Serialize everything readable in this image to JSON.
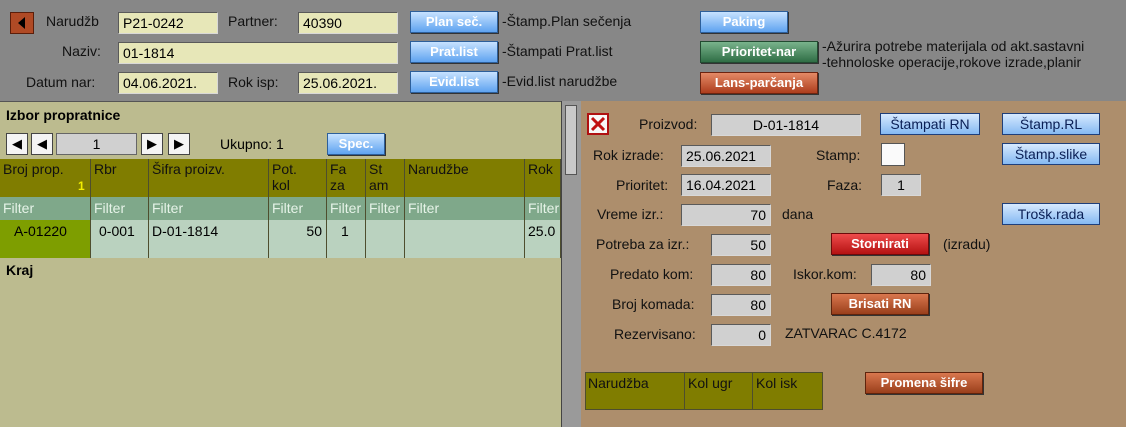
{
  "header": {
    "back_icon": "triangle-left-icon",
    "narudzba_label": "Narudžb",
    "narudzba_value": "P21-0242",
    "partner_label": "Partner:",
    "partner_value": "40390",
    "naziv_label": "Naziv:",
    "naziv_value": "01-1814",
    "datum_label": "Datum nar:",
    "datum_value": "04.06.2021.",
    "rok_label": "Rok isp:",
    "rok_value": "25.06.2021.",
    "plan_btn": "Plan seč.",
    "plan_note": "-Štamp.Plan sečenja",
    "prat_btn": "Prat.list",
    "prat_note": "-Štampati Prat.list",
    "evid_btn": "Evid.list",
    "evid_note": "-Evid.list narudžbe",
    "paking_btn": "Paking",
    "prioritet_btn": "Prioritet-nar",
    "prioritet_note1": "-Ažurira potrebe materijala od akt.sastavni",
    "prioritet_note2": "-tehnoloske operacije,rokove izrade,planir",
    "lans_btn": "Lans-parčanja"
  },
  "left": {
    "title": "Izbor propratnice",
    "nav_first": "◀",
    "nav_prev": "◀",
    "page": "1",
    "nav_next": "▶",
    "nav_last": "▶",
    "total": "Ukupno: 1",
    "spec_btn": "Spec.",
    "columns": [
      "Broj prop.",
      "Rbr",
      "Šifra proizv.",
      "Pot.\nkol",
      "Fa\nza",
      "St\nam",
      "Narudžbe",
      "Rok"
    ],
    "sort_indicator": "1",
    "filter_text": "Filter",
    "row": [
      "A-01220",
      "0-001",
      "D-01-1814",
      "50",
      "1",
      "",
      "",
      "25.0"
    ],
    "footer": "Kraj"
  },
  "right": {
    "close_icon": "close-x-icon",
    "proizvod_label": "Proizvod:",
    "proizvod_value": "D-01-1814",
    "stampati_rn_btn": "Štampati RN",
    "stamp_rl_btn": "Štamp.RL",
    "stamp_slike_btn": "Štamp.slike",
    "rok_izrade_label": "Rok izrade:",
    "rok_izrade_value": "25.06.2021",
    "stamp_label": "Stamp:",
    "prioritet_label": "Prioritet:",
    "prioritet_value": "16.04.2021",
    "faza_label": "Faza:",
    "faza_value": "1",
    "vreme_label": "Vreme izr.:",
    "vreme_value": "70",
    "vreme_unit": "dana",
    "trosk_btn": "Trošk.rada",
    "potreba_label": "Potreba za izr.:",
    "potreba_value": "50",
    "stornirati_btn": "Stornirati",
    "izradu_note": "(izradu)",
    "predato_label": "Predato kom:",
    "predato_value": "80",
    "iskor_label": "Iskor.kom:",
    "iskor_value": "80",
    "broj_label": "Broj komada:",
    "broj_value": "80",
    "brisati_btn": "Brisati RN",
    "rezervisano_label": "Rezervisano:",
    "rezervisano_value": "0",
    "zatvarac_text": "ZATVARAC C.4172",
    "sub_columns": [
      "Narudžba",
      "Kol ugr",
      "Kol isk"
    ],
    "promena_btn": "Promena šifre"
  }
}
